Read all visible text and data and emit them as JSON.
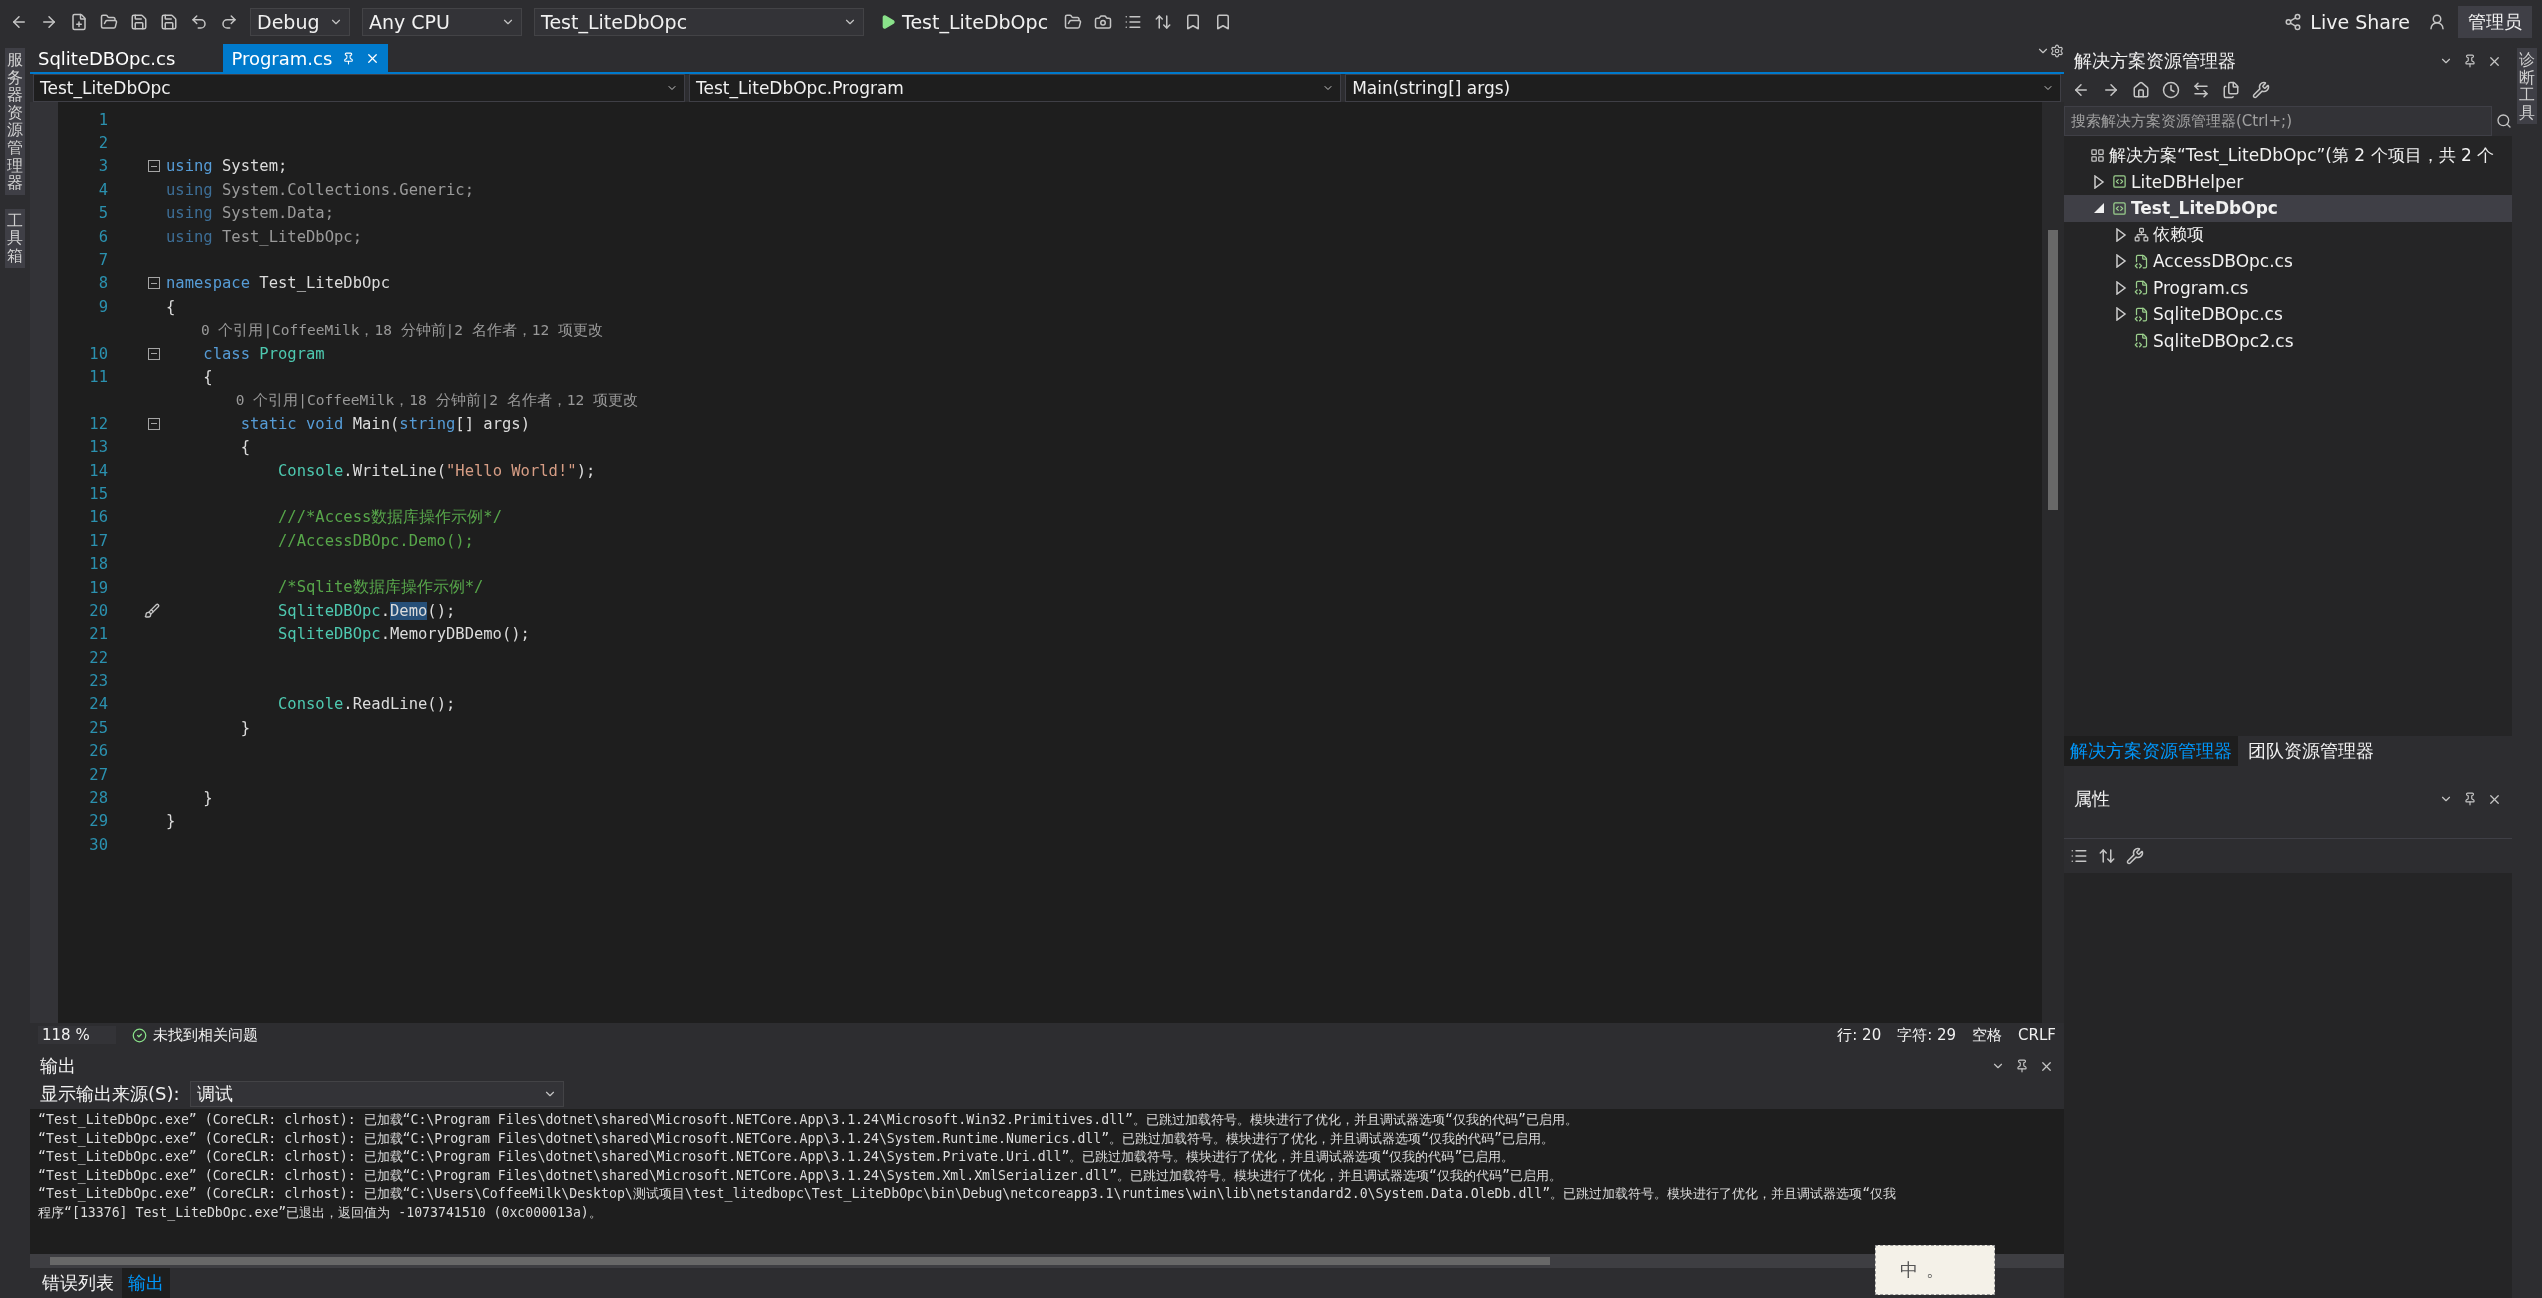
{
  "toolbar": {
    "dropdowns": [
      {
        "label": "Debug"
      },
      {
        "label": "Any CPU"
      },
      {
        "label": "Test_LiteDbOpc"
      }
    ],
    "run_label": "Test_LiteDbOpc",
    "live_share": "Live Share",
    "account": "管理员"
  },
  "left_strip": [
    "服务器资源管理器",
    "工具箱"
  ],
  "right_strip": [
    "诊断工具"
  ],
  "doc_tabs": [
    {
      "label": "SqliteDBOpc.cs",
      "selected": false
    },
    {
      "label": "Program.cs",
      "selected": true
    }
  ],
  "nav_bar": [
    "Test_LiteDbOpc",
    "Test_LiteDbOpc.Program",
    "Main(string[] args)"
  ],
  "code": {
    "lines": [
      {
        "kind": "code",
        "number": "1",
        "foldable": false,
        "marker": false
      },
      {
        "kind": "code",
        "number": "2",
        "foldable": false,
        "marker": false
      },
      {
        "kind": "code",
        "number": "3",
        "foldable": true,
        "marker": false,
        "tokens": [
          {
            "kind": "keyword",
            "text": "using"
          },
          {
            "kind": "plain",
            "text": " System;"
          }
        ]
      },
      {
        "kind": "code",
        "number": "4",
        "foldable": false,
        "marker": false,
        "tokens": [
          {
            "kind": "unused_keyword",
            "text": "using"
          },
          {
            "kind": "unused",
            "text": " System.Collections.Generic;"
          }
        ]
      },
      {
        "kind": "code",
        "number": "5",
        "foldable": false,
        "marker": false,
        "tokens": [
          {
            "kind": "unused_keyword",
            "text": "using"
          },
          {
            "kind": "unused",
            "text": " System.Data;"
          }
        ]
      },
      {
        "kind": "code",
        "number": "6",
        "foldable": false,
        "marker": false,
        "tokens": [
          {
            "kind": "unused_keyword",
            "text": "using"
          },
          {
            "kind": "unused",
            "text": " Test_LiteDbOpc;"
          }
        ]
      },
      {
        "kind": "code",
        "number": "7",
        "foldable": false,
        "marker": false
      },
      {
        "kind": "code",
        "number": "8",
        "foldable": true,
        "marker": false,
        "tokens": [
          {
            "kind": "keyword",
            "text": "namespace"
          },
          {
            "kind": "plain",
            "text": " Test_LiteDbOpc"
          }
        ]
      },
      {
        "kind": "code",
        "number": "9",
        "foldable": false,
        "marker": false,
        "tokens": [
          {
            "kind": "plain",
            "text": "{"
          }
        ]
      },
      {
        "kind": "codelens",
        "text": "    0 个引用|CoffeeMilk，18 分钟前|2 名作者，12 项更改"
      },
      {
        "kind": "code",
        "number": "10",
        "foldable": true,
        "marker": false,
        "tokens": [
          {
            "kind": "keyword",
            "text": "    class"
          },
          {
            "kind": "type",
            "text": " Program"
          }
        ]
      },
      {
        "kind": "code",
        "number": "11",
        "foldable": false,
        "marker": false,
        "tokens": [
          {
            "kind": "plain",
            "text": "    {"
          }
        ]
      },
      {
        "kind": "codelens",
        "text": "        0 个引用|CoffeeMilk，18 分钟前|2 名作者，12 项更改"
      },
      {
        "kind": "code",
        "number": "12",
        "foldable": true,
        "marker": false,
        "tokens": [
          {
            "kind": "keyword",
            "text": "        static void"
          },
          {
            "kind": "plain",
            "text": " Main("
          },
          {
            "kind": "keyword",
            "text": "string"
          },
          {
            "kind": "plain",
            "text": "[] args)"
          }
        ]
      },
      {
        "kind": "code",
        "number": "13",
        "foldable": false,
        "marker": false,
        "tokens": [
          {
            "kind": "plain",
            "text": "        {"
          }
        ]
      },
      {
        "kind": "code",
        "number": "14",
        "foldable": false,
        "marker": false,
        "tokens": [
          {
            "kind": "type",
            "text": "            Console"
          },
          {
            "kind": "plain",
            "text": ".WriteLine("
          },
          {
            "kind": "string",
            "text": "\"Hello World!\""
          },
          {
            "kind": "plain",
            "text": ");"
          }
        ]
      },
      {
        "kind": "code",
        "number": "15",
        "foldable": false,
        "marker": false
      },
      {
        "kind": "code",
        "number": "16",
        "foldable": false,
        "marker": false,
        "tokens": [
          {
            "kind": "comment",
            "text": "            ///*Access数据库操作示例*/"
          }
        ]
      },
      {
        "kind": "code",
        "number": "17",
        "foldable": false,
        "marker": false,
        "tokens": [
          {
            "kind": "comment",
            "text": "            //AccessDBOpc.Demo();"
          }
        ]
      },
      {
        "kind": "code",
        "number": "18",
        "foldable": false,
        "marker": false
      },
      {
        "kind": "code",
        "number": "19",
        "foldable": false,
        "marker": false,
        "tokens": [
          {
            "kind": "comment",
            "text": "            /*Sqlite数据库操作示例*/"
          }
        ]
      },
      {
        "kind": "code",
        "number": "20",
        "foldable": false,
        "marker": true,
        "tokens": [
          {
            "kind": "type",
            "text": "            SqliteDBOpc"
          },
          {
            "kind": "plain",
            "text": "."
          },
          {
            "kind": "selected",
            "text": "Demo"
          },
          {
            "kind": "plain",
            "text": "();"
          }
        ]
      },
      {
        "kind": "code",
        "number": "21",
        "foldable": false,
        "marker": false,
        "tokens": [
          {
            "kind": "type",
            "text": "            SqliteDBOpc"
          },
          {
            "kind": "plain",
            "text": ".MemoryDBDemo();"
          }
        ]
      },
      {
        "kind": "code",
        "number": "22",
        "foldable": false,
        "marker": false
      },
      {
        "kind": "code",
        "number": "23",
        "foldable": false,
        "marker": false
      },
      {
        "kind": "code",
        "number": "24",
        "foldable": false,
        "marker": false,
        "tokens": [
          {
            "kind": "type",
            "text": "            Console"
          },
          {
            "kind": "plain",
            "text": ".ReadLine();"
          }
        ]
      },
      {
        "kind": "code",
        "number": "25",
        "foldable": false,
        "marker": false,
        "tokens": [
          {
            "kind": "plain",
            "text": "        }"
          }
        ]
      },
      {
        "kind": "code",
        "number": "26",
        "foldable": false,
        "marker": false
      },
      {
        "kind": "code",
        "number": "27",
        "foldable": false,
        "marker": false
      },
      {
        "kind": "code",
        "number": "28",
        "foldable": false,
        "marker": false,
        "tokens": [
          {
            "kind": "plain",
            "text": "    }"
          }
        ]
      },
      {
        "kind": "code",
        "number": "29",
        "foldable": false,
        "marker": false,
        "tokens": [
          {
            "kind": "plain",
            "text": "}"
          }
        ]
      },
      {
        "kind": "code",
        "number": "30",
        "foldable": false,
        "marker": false
      }
    ]
  },
  "status_bar": {
    "zoom": "118 %",
    "issues": "未找到相关问题",
    "line": "行: 20",
    "char": "字符: 29",
    "spaces": "空格",
    "eol": "CRLF"
  },
  "output": {
    "title": "输出",
    "source_label": "显示输出来源(S):",
    "source": "调试",
    "lines": [
      "“Test_LiteDbOpc.exe” (CoreCLR: clrhost): 已加载“C:\\Program Files\\dotnet\\shared\\Microsoft.NETCore.App\\3.1.24\\Microsoft.Win32.Primitives.dll”。已跳过加载符号。模块进行了优化，并且调试器选项“仅我的代码”已启用。",
      "“Test_LiteDbOpc.exe” (CoreCLR: clrhost): 已加载“C:\\Program Files\\dotnet\\shared\\Microsoft.NETCore.App\\3.1.24\\System.Runtime.Numerics.dll”。已跳过加载符号。模块进行了优化，并且调试器选项“仅我的代码”已启用。",
      "“Test_LiteDbOpc.exe” (CoreCLR: clrhost): 已加载“C:\\Program Files\\dotnet\\shared\\Microsoft.NETCore.App\\3.1.24\\System.Private.Uri.dll”。已跳过加载符号。模块进行了优化，并且调试器选项“仅我的代码”已启用。",
      "“Test_LiteDbOpc.exe” (CoreCLR: clrhost): 已加载“C:\\Program Files\\dotnet\\shared\\Microsoft.NETCore.App\\3.1.24\\System.Xml.XmlSerializer.dll”。已跳过加载符号。模块进行了优化，并且调试器选项“仅我的代码”已启用。",
      "“Test_LiteDbOpc.exe” (CoreCLR: clrhost): 已加载“C:\\Users\\CoffeeMilk\\Desktop\\测试项目\\test_litedbopc\\Test_LiteDbOpc\\bin\\Debug\\netcoreapp3.1\\runtimes\\win\\lib\\netstandard2.0\\System.Data.OleDb.dll”。已跳过加载符号。模块进行了优化，并且调试器选项“仅我",
      "程序“[13376] Test_LiteDbOpc.exe”已退出，返回值为 -1073741510 (0xc000013a)。"
    ]
  },
  "bottom_tabs": [
    {
      "label": "错误列表",
      "selected": false
    },
    {
      "label": "输出",
      "selected": true
    }
  ],
  "solution_explorer": {
    "title": "解决方案资源管理器",
    "search_placeholder": "搜索解决方案资源管理器(Ctrl+;)",
    "tree": [
      {
        "kind": "solution",
        "label": "解决方案“Test_LiteDbOpc”(第 2 个项目，共 2 个",
        "selected": false,
        "children": [
          {
            "kind": "project",
            "label": "LiteDBHelper",
            "expandable": true,
            "expanded": false,
            "selected": false
          },
          {
            "kind": "project",
            "label": "Test_LiteDbOpc",
            "expandable": true,
            "expanded": true,
            "selected": true,
            "children": [
              {
                "kind": "dependencies",
                "label": "依赖项",
                "expandable": true,
                "expanded": false,
                "selected": false
              },
              {
                "kind": "file",
                "label": "AccessDBOpc.cs",
                "expandable": true,
                "expanded": false,
                "selected": false
              },
              {
                "kind": "file",
                "label": "Program.cs",
                "expandable": true,
                "expanded": false,
                "selected": false
              },
              {
                "kind": "file",
                "label": "SqliteDBOpc.cs",
                "expandable": true,
                "expanded": false,
                "selected": false
              },
              {
                "kind": "file",
                "label": "SqliteDBOpc2.cs",
                "expandable": false,
                "expanded": false,
                "selected": false
              }
            ]
          }
        ]
      }
    ],
    "tabs": [
      {
        "label": "解决方案资源管理器",
        "selected": true
      },
      {
        "label": "团队资源管理器",
        "selected": false
      }
    ]
  },
  "properties": {
    "title": "属性"
  },
  "ime": {
    "mode": "中",
    "punct": "。"
  }
}
